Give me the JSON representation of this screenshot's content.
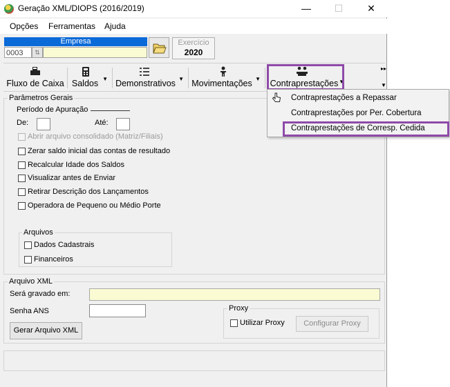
{
  "window": {
    "title": "Geração XML/DIOPS (2016/2019)",
    "minimize_glyph": "—",
    "maximize_glyph": "☐",
    "close_glyph": "✕"
  },
  "menu": [
    "Opções",
    "Ferramentas",
    "Ajuda"
  ],
  "empresa": {
    "header": "Empresa",
    "code": "0003",
    "name": ""
  },
  "exercicio": {
    "label": "Exercício",
    "value": "2020"
  },
  "toolbar": {
    "buttons": [
      {
        "label": "Fluxo de Caixa",
        "icon": "cash-register-icon"
      },
      {
        "label": "Saldos",
        "icon": "calculator-icon"
      },
      {
        "label": "Demonstrativos",
        "icon": "list-icon"
      },
      {
        "label": "Movimentações",
        "icon": "person-icon"
      },
      {
        "label": "Contraprestações",
        "icon": "people-icon"
      }
    ]
  },
  "parametros": {
    "title": "Parâmetros Gerais",
    "periodo_label": "Período de Apuração",
    "de_label": "De:",
    "ate_label": "Até:",
    "options": [
      {
        "label": "Abrir arquivo consolidado (Matriz/Filiais)",
        "checked": false,
        "enabled": false
      },
      {
        "label": "Zerar saldo inicial das contas de resultado",
        "checked": false,
        "enabled": true
      },
      {
        "label": "Recalcular Idade dos Saldos",
        "checked": false,
        "enabled": true
      },
      {
        "label": "Visualizar antes de Enviar",
        "checked": false,
        "enabled": true
      },
      {
        "label": "Retirar Descrição dos Lançamentos",
        "checked": false,
        "enabled": true
      },
      {
        "label": "Operadora de Pequeno ou Médio Porte",
        "checked": false,
        "enabled": true
      }
    ],
    "arquivos": {
      "title": "Arquivos",
      "items": [
        {
          "label": "Dados Cadastrais",
          "checked": false
        },
        {
          "label": "Financeiros",
          "checked": false
        }
      ]
    }
  },
  "arquivo_xml": {
    "title": "Arquivo XML",
    "gravado_label": "Será gravado em:",
    "gravado_value": "",
    "senha_label": "Senha ANS",
    "senha_value": "",
    "gerar_label": "Gerar Arquivo XML",
    "proxy": {
      "title": "Proxy",
      "use_label": "Utilizar Proxy",
      "config_label": "Configurar Proxy"
    }
  },
  "contraprestacoes_menu": {
    "items": [
      "Contraprestações a Repassar",
      "Contraprestações por Per. Cobertura",
      "Contraprestações de Corresp. Cedida"
    ]
  },
  "colors": {
    "highlight": "#8e4aa8",
    "empresa_header": "#0a6ad8",
    "field_yellow": "#fbfbd3"
  }
}
